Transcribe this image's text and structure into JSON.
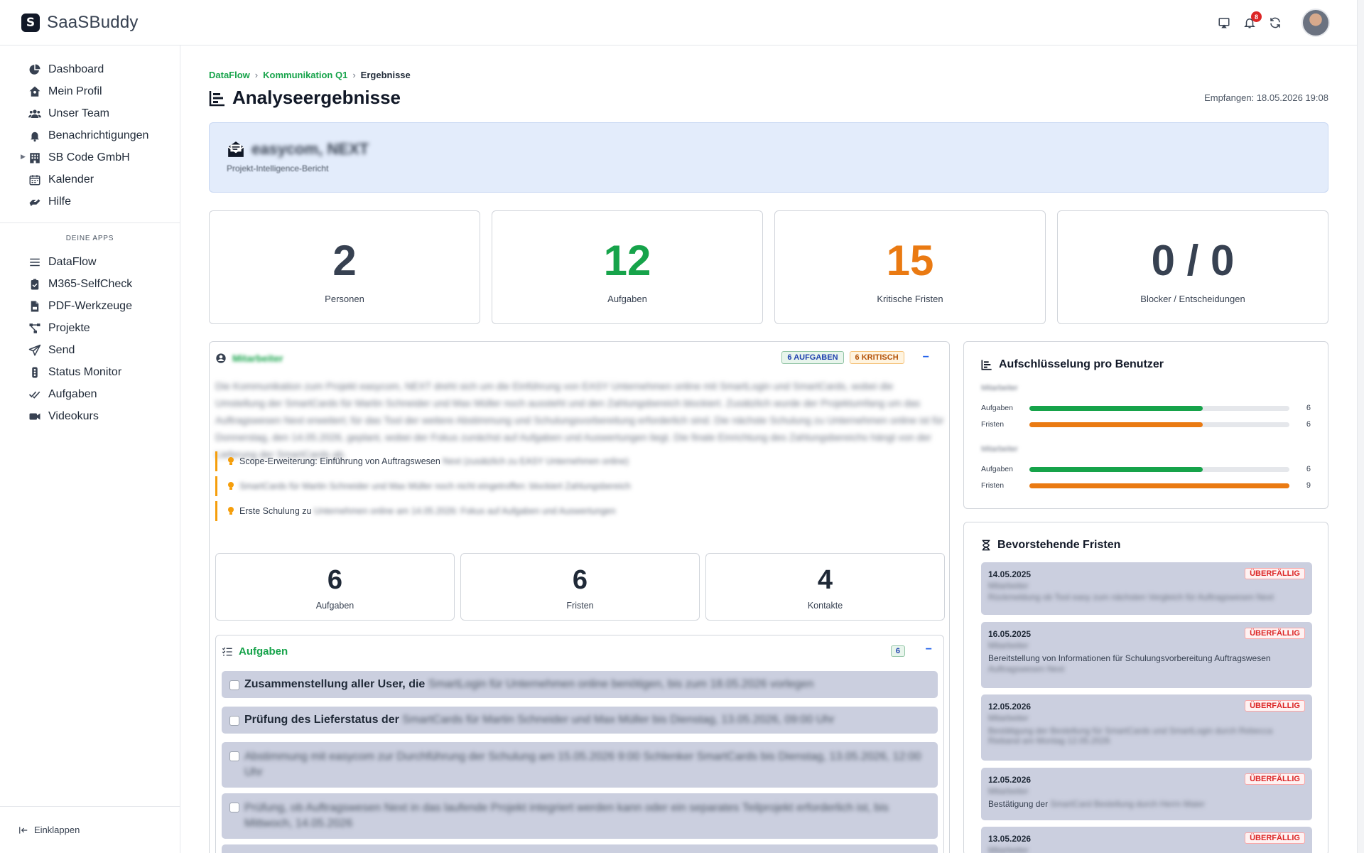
{
  "app": {
    "name": "SaaSBuddy",
    "notifications_count": "8"
  },
  "sidebar": {
    "items": [
      {
        "label": "Dashboard",
        "icon": "chart-pie-icon"
      },
      {
        "label": "Mein Profil",
        "icon": "house-user-icon"
      },
      {
        "label": "Unser Team",
        "icon": "users-icon"
      },
      {
        "label": "Benachrichtigungen",
        "icon": "bell-icon"
      },
      {
        "label": "SB Code GmbH",
        "icon": "building-icon"
      },
      {
        "label": "Kalender",
        "icon": "calendar-icon"
      },
      {
        "label": "Hilfe",
        "icon": "hands-helping-icon"
      }
    ],
    "section_title": "DEINE APPS",
    "apps": [
      {
        "label": "DataFlow",
        "icon": "list-icon"
      },
      {
        "label": "M365-SelfCheck",
        "icon": "clipboard-check-icon"
      },
      {
        "label": "PDF-Werkzeuge",
        "icon": "file-pdf-icon"
      },
      {
        "label": "Projekte",
        "icon": "project-diagram-icon"
      },
      {
        "label": "Send",
        "icon": "paper-plane-icon"
      },
      {
        "label": "Status Monitor",
        "icon": "traffic-light-icon"
      },
      {
        "label": "Aufgaben",
        "icon": "check-double-icon"
      },
      {
        "label": "Videokurs",
        "icon": "video-icon"
      }
    ],
    "collapse_label": "Einklappen"
  },
  "breadcrumb": {
    "items": [
      "DataFlow",
      "Kommunikation Q1"
    ],
    "current": "Ergebnisse"
  },
  "page": {
    "title": "Analyseergebnisse",
    "received": "Empfangen: 18.05.2026 19:08"
  },
  "banner": {
    "title": "easycom, NEXT",
    "subtitle": "Projekt-Intelligence-Bericht"
  },
  "stats": [
    {
      "value": "2",
      "label": "Personen",
      "color": "#374151"
    },
    {
      "value": "12",
      "label": "Aufgaben",
      "color": "#16a34a"
    },
    {
      "value": "15",
      "label": "Kritische Fristen",
      "color": "#ea7a12"
    },
    {
      "value": "0 / 0",
      "label": "Blocker / Entscheidungen",
      "color": "#374151"
    }
  ],
  "person": {
    "name": "Mitarbeiter",
    "badge_tasks": "6 AUFGABEN",
    "badge_critical": "6 KRITISCH",
    "summary": "Die Kommunikation zum Projekt easycom, NEXT dreht sich um die Einführung von EASY Unternehmen online mit SmartLogin und SmartCards, wobei die Umstellung der SmartCards für Martin Schneider und Max Müller noch aussteht und den Zahlungsbereich blockiert. Zusätzlich wurde der Projektumfang um das Auftragswesen Next erweitert; für das Tool der weitere Abstimmung und Schulungsvorbereitung erforderlich sind. Die nächste Schulung zu Unternehmen online ist für Donnerstag, den 14.05.2026, geplant, wobei der Fokus zunächst auf Aufgaben und Auswertungen liegt. Die finale Einrichtung des Zahlungsbereichs hängt von der Lieferung der SmartCards ab.",
    "highlights": [
      {
        "text": "Scope-Erweiterung: Einführung von Auftragswesen",
        "hidden": "Next (zusätzlich zu EASY Unternehmen online)"
      },
      {
        "text": "",
        "hidden": "SmartCards für Martin Schneider und Max Müller noch nicht eingetroffen: blockiert Zahlungsbereich"
      },
      {
        "text": "Erste Schulung zu",
        "hidden": "Unternehmen online am 14.05.2026: Fokus auf Aufgaben und Auswertungen"
      }
    ],
    "mini_stats": [
      {
        "value": "6",
        "label": "Aufgaben"
      },
      {
        "value": "6",
        "label": "Fristen"
      },
      {
        "value": "4",
        "label": "Kontakte"
      }
    ]
  },
  "tasks": {
    "title": "Aufgaben",
    "count": "6",
    "items": [
      {
        "text": "Zusammenstellung aller User, die",
        "hidden": "SmartLogin für Unternehmen online benötigen, bis zum 18.05.2026 vorlegen"
      },
      {
        "text": "Prüfung des Lieferstatus der",
        "hidden": "SmartCards für Martin Schneider und Max Müller bis Dienstag, 13.05.2026, 09:00 Uhr"
      },
      {
        "text": "",
        "hidden": "Abstimmung mit easycom zur Durchführung der Schulung am 15.05.2026 9:00 Schlenker SmartCards bis Dienstag, 13.05.2026, 12:00 Uhr"
      },
      {
        "text": "",
        "hidden": "Prüfung, ob Auftragswesen Next in das laufende Projekt integriert werden kann oder ein separates Teilprojekt erforderlich ist, bis Mittwoch, 14.05.2026"
      }
    ]
  },
  "breakdown": {
    "title": "Aufschlüsselung pro Benutzer",
    "users": [
      {
        "name": "Mitarbeiter",
        "rows": [
          {
            "label": "Aufgaben",
            "value": 6,
            "fill": 0.667,
            "color": "#16a34a"
          },
          {
            "label": "Fristen",
            "value": 6,
            "fill": 0.667,
            "color": "#ea7a12"
          }
        ]
      },
      {
        "name": "Mitarbeiter",
        "rows": [
          {
            "label": "Aufgaben",
            "value": 6,
            "fill": 0.667,
            "color": "#16a34a"
          },
          {
            "label": "Fristen",
            "value": 9,
            "fill": 1.0,
            "color": "#ea7a12"
          }
        ]
      }
    ]
  },
  "deadlines": {
    "title": "Bevorstehende Fristen",
    "overdue_label": "ÜBERFÄLLIG",
    "items": [
      {
        "date": "14.05.2025",
        "who": "Mitarbeiter",
        "text": "",
        "hidden": "Rückmeldung ob Tool easy zum nächsten Vergleich für Auftragswesen Next"
      },
      {
        "date": "16.05.2025",
        "who": "Mitarbeiter",
        "text": "Bereitstellung von Informationen für Schulungsvorbereitung Auftragswesen",
        "hidden": "Auftragswesen Next"
      },
      {
        "date": "12.05.2026",
        "who": "Mitarbeiter",
        "text": "",
        "hidden": "Bestätigung der Bestellung für SmartCards und SmartLogin durch Rebecca Rieband am Montag 12.05.2026"
      },
      {
        "date": "12.05.2026",
        "who": "Mitarbeiter",
        "text": "Bestätigung der",
        "hidden": "SmartCard Bestellung durch Herrn Maier"
      },
      {
        "date": "13.05.2026",
        "who": "Mitarbeiter",
        "text": "",
        "hidden": ""
      }
    ]
  }
}
